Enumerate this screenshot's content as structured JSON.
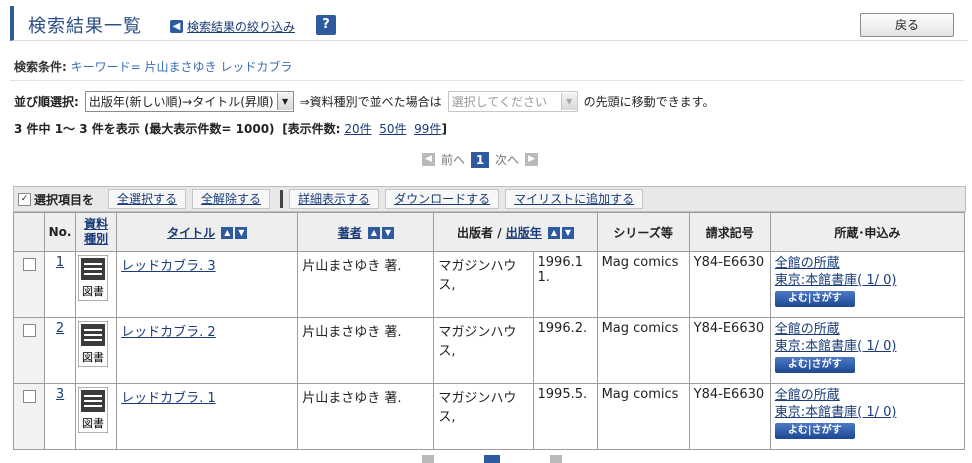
{
  "header": {
    "title": "検索結果一覧",
    "refine_label": "検索結果の絞り込み",
    "help_label": "?",
    "back_label": "戻る"
  },
  "condition": {
    "label": "検索条件:",
    "value": "キーワード= 片山まさゆき レッドカブラ"
  },
  "sort": {
    "label": "並び順選択:",
    "selected": "出版年(新しい順)→タイトル(昇順)",
    "mid_text": "⇒資料種別で並べた場合は",
    "type_placeholder": "選択してください",
    "tail_text": "の先頭に移動できます。"
  },
  "count": {
    "text": "3 件中 1～ 3 件を表示 (最大表示件数= 1000)",
    "display_label": "[表示件数:",
    "opt_20": "20件",
    "opt_50": "50件",
    "opt_99": "99件",
    "close": "]"
  },
  "pager": {
    "prev": "前へ",
    "current": "1",
    "next": "次へ"
  },
  "actions": {
    "label": "選択項目を",
    "select_all": "全選択する",
    "deselect_all": "全解除する",
    "detail": "詳細表示する",
    "download": "ダウンロードする",
    "mylist": "マイリストに追加する"
  },
  "table": {
    "headers": {
      "no": "No.",
      "type": "資料種別",
      "title": "タイトル",
      "author": "著者",
      "publisher": "出版者",
      "slash": "/",
      "year": "出版年",
      "series": "シリーズ等",
      "call": "請求記号",
      "holdings": "所蔵･申込み"
    },
    "rows": [
      {
        "no": "1",
        "type": "図書",
        "title": "レッドカブラ. 3",
        "author": "片山まさゆき 著.",
        "publisher": "マガジンハウス,",
        "year": "1996.11.",
        "series": "Mag comics",
        "call": "Y84-E6630",
        "hold_all": "全館の所蔵",
        "hold_loc": "東京:本館書庫( 1/ 0)",
        "yomu": "よむ|さがす"
      },
      {
        "no": "2",
        "type": "図書",
        "title": "レッドカブラ. 2",
        "author": "片山まさゆき 著.",
        "publisher": "マガジンハウス,",
        "year": "1996.2.",
        "series": "Mag comics",
        "call": "Y84-E6630",
        "hold_all": "全館の所蔵",
        "hold_loc": "東京:本館書庫( 1/ 0)",
        "yomu": "よむ|さがす"
      },
      {
        "no": "3",
        "type": "図書",
        "title": "レッドカブラ. 1",
        "author": "片山まさゆき 著.",
        "publisher": "マガジンハウス,",
        "year": "1995.5.",
        "series": "Mag comics",
        "call": "Y84-E6630",
        "hold_all": "全館の所蔵",
        "hold_loc": "東京:本館書庫( 1/ 0)",
        "yomu": "よむ|さがす"
      }
    ]
  },
  "colors": {
    "accent": "#2e5aa0",
    "link": "#1a3c7a",
    "condition_value": "#3a6db5"
  }
}
